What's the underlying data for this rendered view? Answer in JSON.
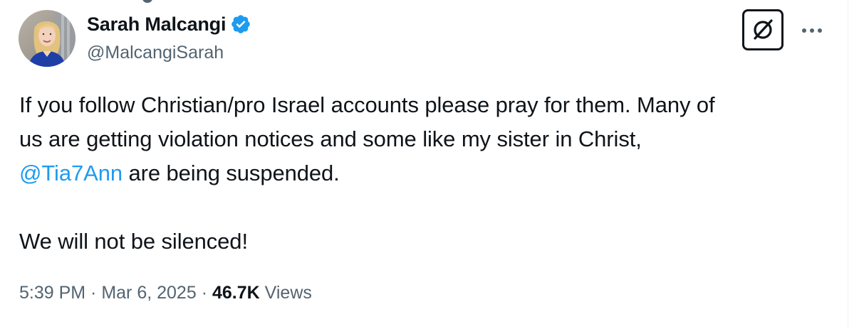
{
  "author": {
    "display_name": "Sarah Malcangi",
    "handle": "@MalcangiSarah",
    "verified": true,
    "verified_color": "#1d9bf0"
  },
  "tweet": {
    "line1": "If you follow Christian/pro Israel accounts please pray for them. Many of",
    "line2": "us are getting violation notices and some like my sister in Christ,",
    "mention": "@Tia7Ann",
    "line3_rest": " are being suspended.",
    "line4": "We will not be silenced!"
  },
  "meta": {
    "time": "5:39 PM",
    "separator": " · ",
    "date": "Mar 6, 2025",
    "views_count": "46.7K",
    "views_label": " Views"
  },
  "icons": {
    "verified": "verified-badge-icon",
    "grok": "grok-icon",
    "more": "more-dots-icon"
  },
  "colors": {
    "text_primary": "#0f1419",
    "text_secondary": "#536471",
    "link": "#1d9bf0"
  }
}
